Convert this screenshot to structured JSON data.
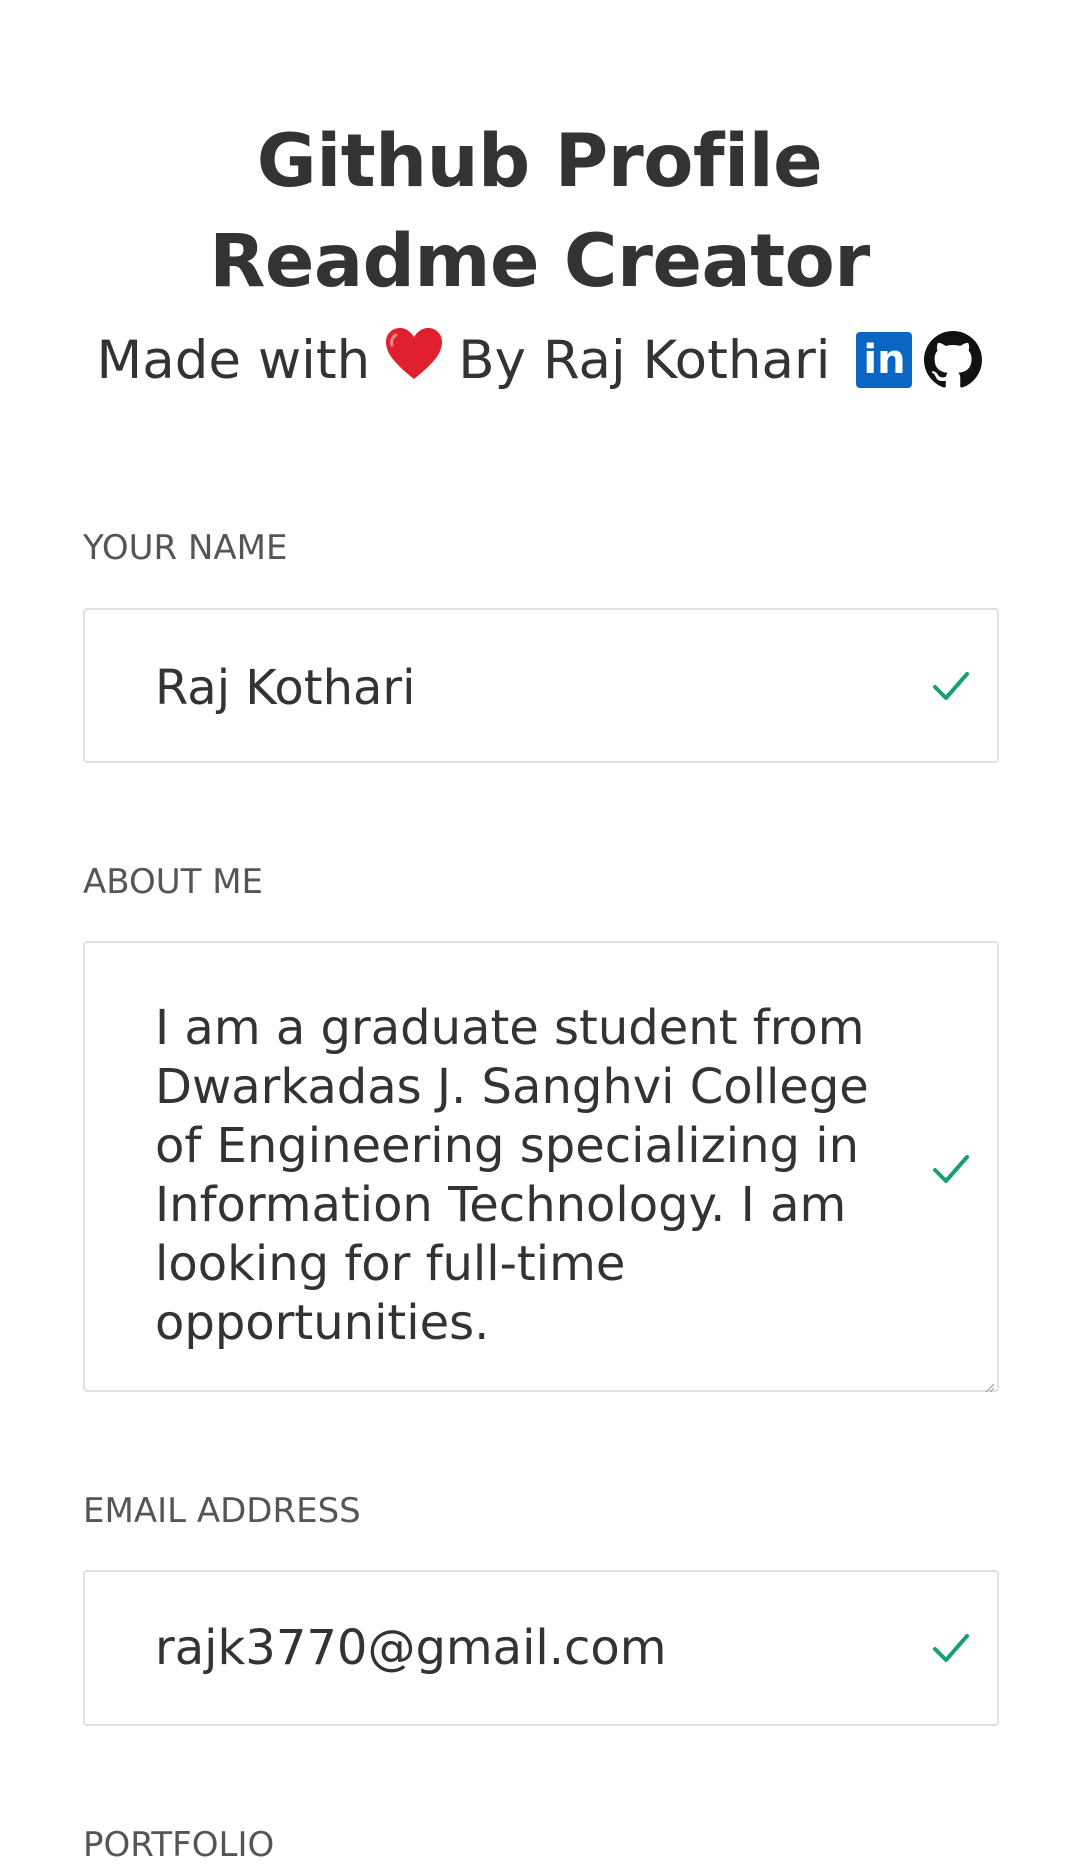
{
  "header": {
    "title_line1": "Github Profile",
    "title_line2": "Readme Creator",
    "byline_prefix": "Made with",
    "byline_suffix": "By Raj Kothari",
    "heart_glyph": "❤️",
    "linkedin_glyph": "in",
    "heart_icon": "heart-icon",
    "linkedin_icon": "linkedin-icon",
    "github_icon": "github-icon"
  },
  "form": {
    "name": {
      "label": "YOUR NAME",
      "value": "Raj Kothari"
    },
    "about": {
      "label": "ABOUT ME",
      "value": "I am a graduate student from Dwarkadas J. Sanghvi College of Engineering specializing in Information Technology. I am looking for full-time opportunities."
    },
    "email": {
      "label": "EMAIL ADDRESS",
      "value": "rajk3770@gmail.com"
    },
    "portfolio": {
      "label": "PORTFOLIO"
    }
  },
  "colors": {
    "valid_check": "#1aa06d",
    "linkedin_brand": "#0a66c2",
    "heart": "#e0202e",
    "border": "#e1e1e1"
  }
}
